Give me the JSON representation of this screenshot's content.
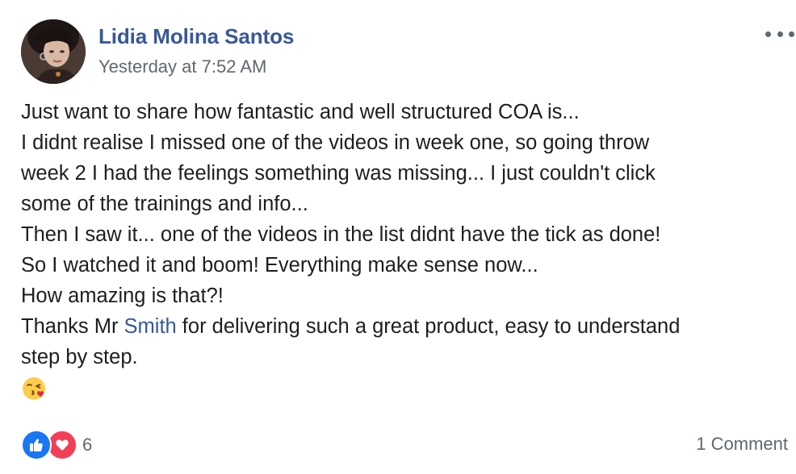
{
  "post": {
    "author": "Lidia Molina Santos",
    "timestamp": "Yesterday at 7:52 AM",
    "body": {
      "line1": "Just want to share how fantastic and well structured COA is...",
      "line2": "I didnt realise I missed one of the videos in week one, so going throw",
      "line3": "week 2 I had the feelings something was missing... I just couldn't click",
      "line4": "some of the trainings and info...",
      "line5": "Then I saw it... one of the videos in the list didnt have the tick as done!",
      "line6": "So I watched it and boom! Everything make sense now...",
      "line7": "How amazing is that?!",
      "line8_before": "Thanks Mr ",
      "line8_mention": "Smith",
      "line8_after": " for delivering such a great product, easy to understand",
      "line9": "step by step.",
      "emoji": "face-blowing-a-kiss"
    },
    "reactions": {
      "types": [
        "like",
        "love"
      ],
      "count": "6"
    },
    "comments_label": "1 Comment"
  },
  "colors": {
    "link": "#385898",
    "secondary_text": "#616770",
    "like_blue": "#1877f2",
    "love_red": "#f33e58"
  }
}
